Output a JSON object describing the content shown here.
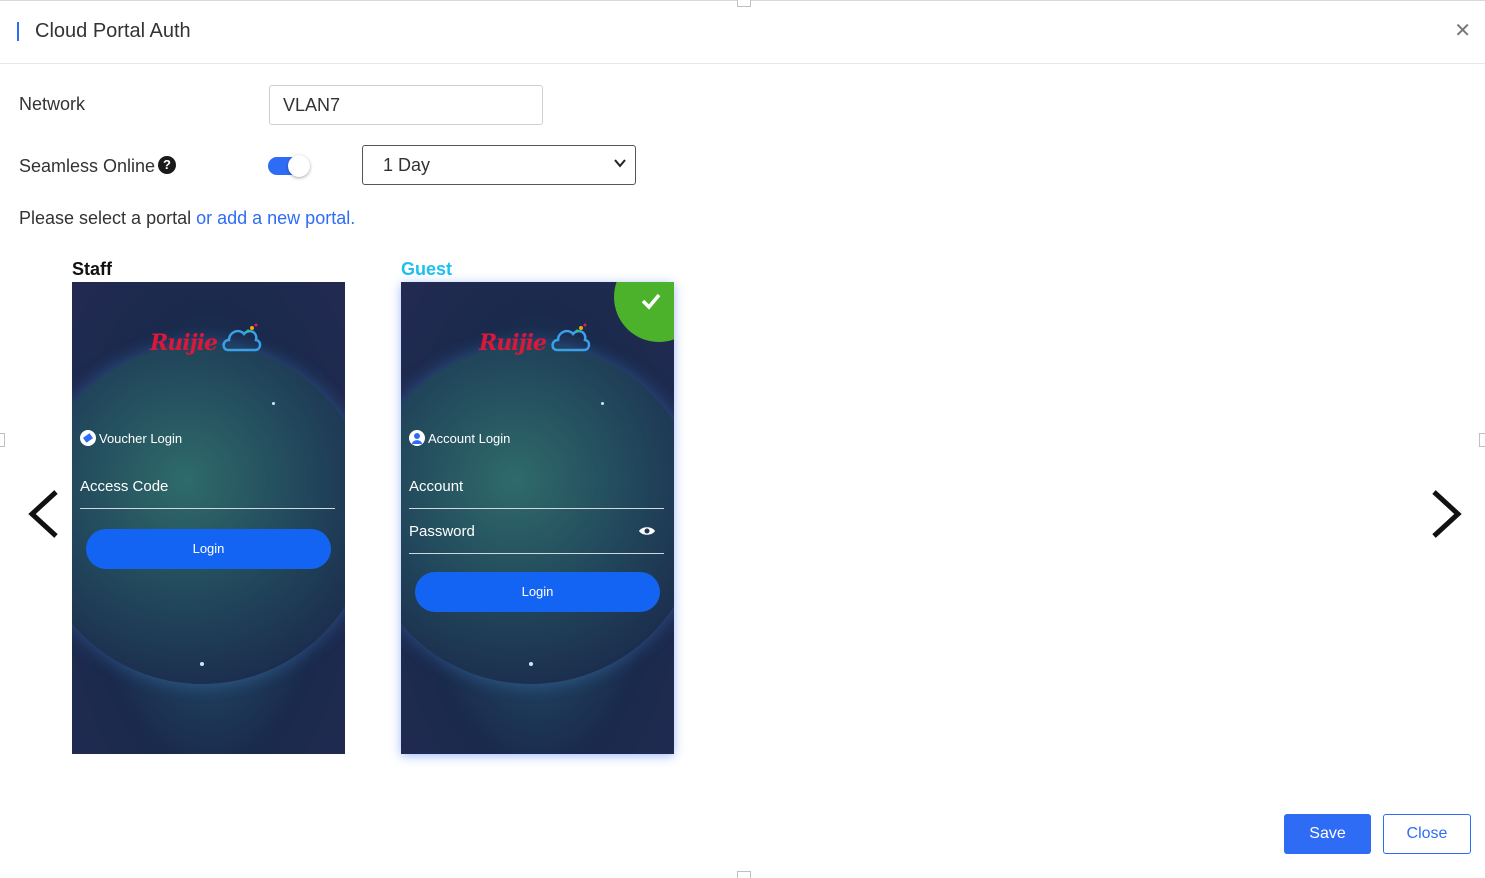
{
  "dialog": {
    "title": "Cloud Portal Auth",
    "close_icon": "close-icon"
  },
  "form": {
    "network_label": "Network",
    "network_value": "VLAN7",
    "seamless_label": "Seamless Online",
    "seamless_enabled": true,
    "seamless_duration": "1 Day",
    "portal_prompt": "Please select a portal ",
    "portal_link": "or add a new portal."
  },
  "portals": [
    {
      "name": "Staff",
      "selected": false,
      "login_type": "Voucher Login",
      "fields": [
        "Access Code"
      ],
      "button": "Login",
      "logo": "Ruijie"
    },
    {
      "name": "Guest",
      "selected": true,
      "login_type": "Account Login",
      "fields": [
        "Account",
        "Password"
      ],
      "button": "Login",
      "logo": "Ruijie"
    }
  ],
  "footer": {
    "save_label": "Save",
    "close_label": "Close"
  },
  "colors": {
    "accent": "#2f6cf6",
    "selected_title": "#1ec0ef",
    "check_green": "#4cb22c"
  }
}
